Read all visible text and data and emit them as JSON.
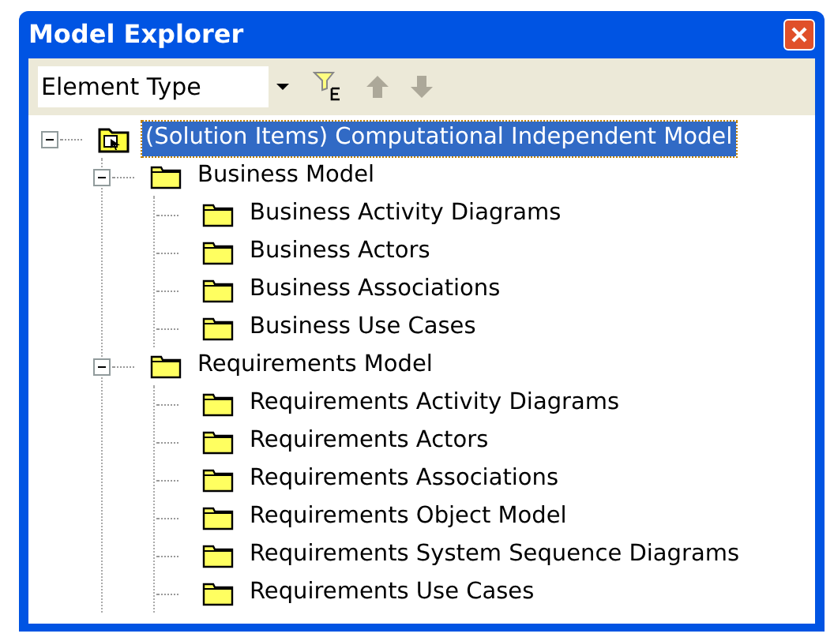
{
  "window": {
    "title": "Model Explorer"
  },
  "toolbar": {
    "dropdown": {
      "value": "Element Type"
    }
  },
  "tree": [
    {
      "label": "(Solution Items) Computational Independent Model",
      "kind": "solution",
      "selected": true,
      "expanded": true,
      "children": [
        {
          "label": "Business Model",
          "kind": "folder",
          "selected": false,
          "expanded": true,
          "children": [
            {
              "label": "Business Activity Diagrams",
              "kind": "folder",
              "selected": false
            },
            {
              "label": "Business Actors",
              "kind": "folder",
              "selected": false
            },
            {
              "label": "Business Associations",
              "kind": "folder",
              "selected": false
            },
            {
              "label": "Business Use Cases",
              "kind": "folder",
              "selected": false
            }
          ]
        },
        {
          "label": "Requirements Model",
          "kind": "folder",
          "selected": false,
          "expanded": true,
          "children": [
            {
              "label": "Requirements Activity Diagrams",
              "kind": "folder",
              "selected": false
            },
            {
              "label": "Requirements Actors",
              "kind": "folder",
              "selected": false
            },
            {
              "label": "Requirements Associations",
              "kind": "folder",
              "selected": false
            },
            {
              "label": "Requirements Object Model",
              "kind": "folder",
              "selected": false
            },
            {
              "label": "Requirements System Sequence Diagrams",
              "kind": "folder",
              "selected": false
            },
            {
              "label": "Requirements Use Cases",
              "kind": "folder",
              "selected": false
            }
          ]
        }
      ]
    }
  ]
}
